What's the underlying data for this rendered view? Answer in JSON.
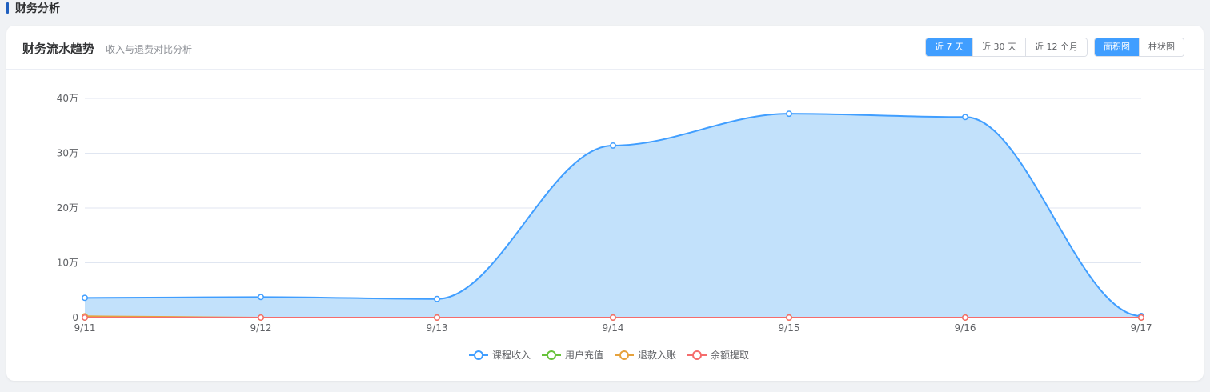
{
  "section": {
    "title": "财务分析"
  },
  "card": {
    "title": "财务流水趋势",
    "subtitle": "收入与退费对比分析"
  },
  "range_buttons": [
    {
      "label": "近 7 天",
      "active": true
    },
    {
      "label": "近 30 天",
      "active": false
    },
    {
      "label": "近 12 个月",
      "active": false
    }
  ],
  "type_buttons": [
    {
      "label": "面积图",
      "active": true
    },
    {
      "label": "柱状图",
      "active": false
    }
  ],
  "chart_data": {
    "type": "area",
    "categories": [
      "9/11",
      "9/12",
      "9/13",
      "9/14",
      "9/15",
      "9/16",
      "9/17"
    ],
    "ylim": [
      0,
      400000
    ],
    "yticks": [
      {
        "value": 0,
        "label": "0"
      },
      {
        "value": 100000,
        "label": "10万"
      },
      {
        "value": 200000,
        "label": "20万"
      },
      {
        "value": 300000,
        "label": "30万"
      },
      {
        "value": 400000,
        "label": "40万"
      }
    ],
    "grid": true,
    "legend_position": "bottom-center",
    "series": [
      {
        "name": "课程收入",
        "color": "#409eff",
        "fill": "#c2e1fb",
        "values": [
          36000,
          37500,
          34000,
          314000,
          372000,
          366000,
          3000
        ]
      },
      {
        "name": "用户充值",
        "color": "#67c23a",
        "values": [
          0,
          0,
          0,
          0,
          0,
          0,
          0
        ]
      },
      {
        "name": "退款入账",
        "color": "#e6a23c",
        "values": [
          2500,
          0,
          0,
          0,
          0,
          0,
          0
        ]
      },
      {
        "name": "余额提取",
        "color": "#f56c6c",
        "values": [
          0,
          0,
          0,
          0,
          0,
          0,
          0
        ]
      }
    ]
  }
}
